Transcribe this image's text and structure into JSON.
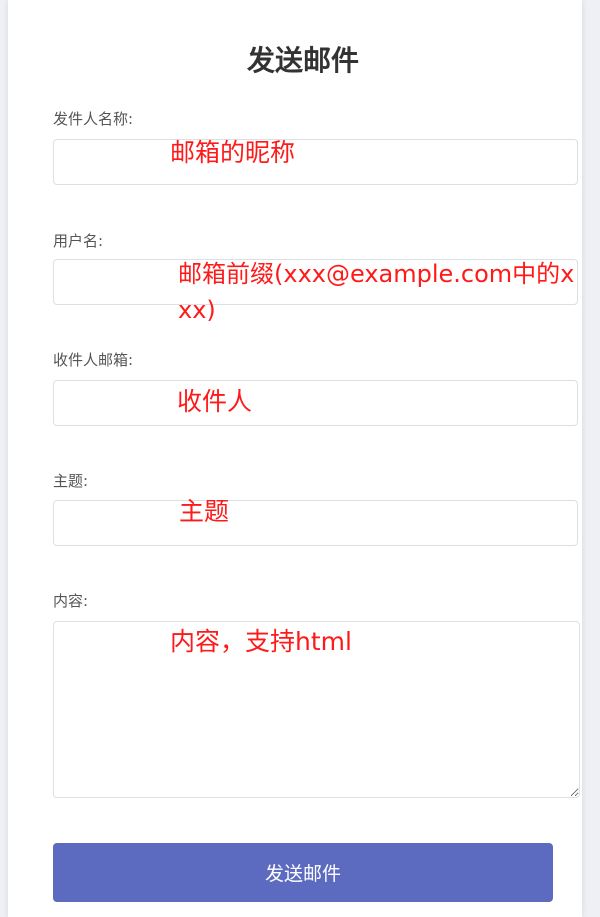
{
  "page": {
    "title": "发送邮件"
  },
  "form": {
    "sender_name_label": "发件人名称:",
    "sender_name_value": "",
    "username_label": "用户名:",
    "username_value": "",
    "recipient_label": "收件人邮箱:",
    "recipient_value": "",
    "subject_label": "主题:",
    "subject_value": "",
    "content_label": "内容:",
    "content_value": "",
    "submit_label": "发送邮件"
  },
  "annotations": {
    "sender_name": "邮箱的昵称",
    "username": "邮箱前缀(xxx@example.com中的xxx)",
    "recipient": "收件人",
    "subject": "主题",
    "content": "内容，支持html"
  },
  "colors": {
    "accent": "#5c6bc0",
    "annotation": "#ff1a1a"
  }
}
